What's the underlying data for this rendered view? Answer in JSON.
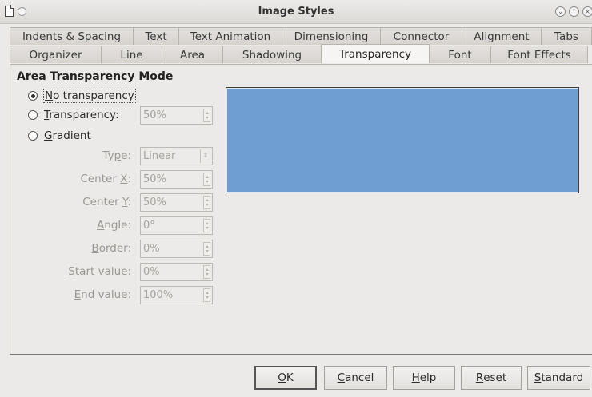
{
  "window": {
    "title": "Image Styles"
  },
  "tabs_row1": [
    "Indents & Spacing",
    "Text",
    "Text Animation",
    "Dimensioning",
    "Connector",
    "Alignment",
    "Tabs"
  ],
  "tabs_row2": [
    "Organizer",
    "Line",
    "Area",
    "Shadowing",
    "Transparency",
    "Font",
    "Font Effects"
  ],
  "active_tab": "Transparency",
  "section": {
    "title": "Area Transparency Mode"
  },
  "mode": {
    "selected": "No transparency",
    "options": [
      {
        "label": "No transparency",
        "mnemonic": "N"
      },
      {
        "label": "Transparency:",
        "mnemonic": "T"
      },
      {
        "label": "Gradient",
        "mnemonic": "G"
      }
    ]
  },
  "transparency_value": "50%",
  "gradient": {
    "type_label": "Type:",
    "type_value": "Linear",
    "center_x_label": "Center X:",
    "center_x_value": "50%",
    "center_y_label": "Center Y:",
    "center_y_value": "50%",
    "angle_label": "Angle:",
    "angle_value": "0°",
    "border_label": "Border:",
    "border_value": "0%",
    "start_label": "Start value:",
    "start_value": "0%",
    "end_label": "End value:",
    "end_value": "100%"
  },
  "preview": {
    "color": "#6f9fd2"
  },
  "buttons": {
    "ok": "OK",
    "cancel": "Cancel",
    "help": "Help",
    "reset": "Reset",
    "standard": "Standard"
  },
  "icons": [
    "document-icon",
    "window-menu-icon",
    "minimize-icon",
    "maximize-icon",
    "close-icon"
  ]
}
